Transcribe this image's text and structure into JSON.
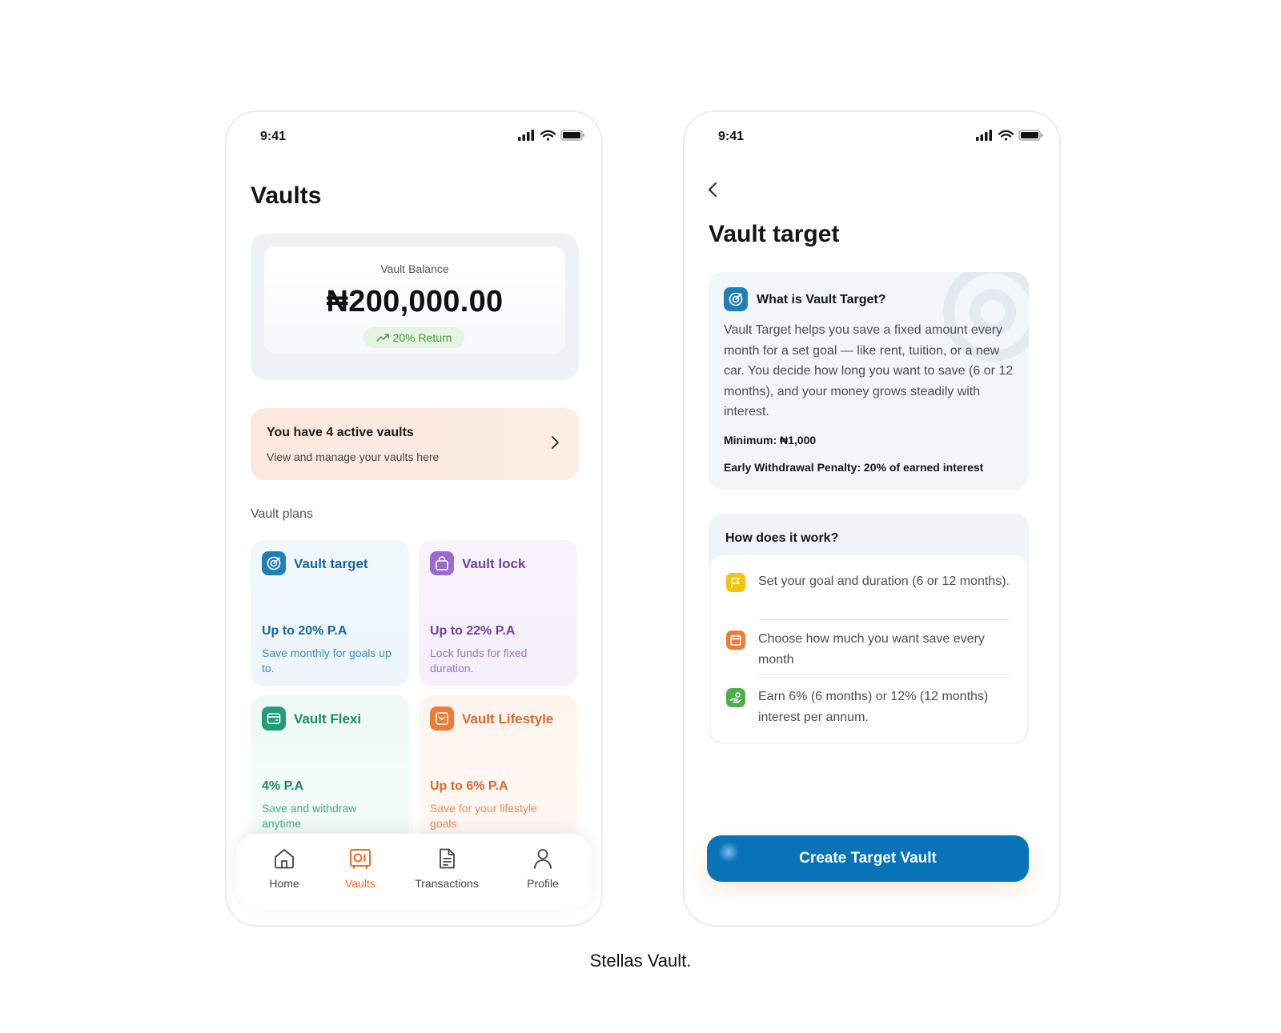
{
  "caption": "Stellas Vault.",
  "colors": {
    "accent_orange": "#ee6a1e",
    "primary_blue": "#0873b6",
    "target_blue": "#1f7fb8",
    "lock_purple": "#9b6ad1",
    "flexi_green": "#1f9e79",
    "lifestyle_orange": "#ee7a36"
  },
  "vaults_screen": {
    "status_time": "9:41",
    "status_icons": [
      "signal-icon",
      "wifi-icon",
      "battery-icon"
    ],
    "title": "Vaults",
    "balance": {
      "label": "Vault Balance",
      "amount": "₦200,000.00",
      "return_badge": "20% Return"
    },
    "active_vaults": {
      "title": "You have 4 active vaults",
      "subtitle": "View and manage your vaults here"
    },
    "plans_label": "Vault plans",
    "plans": [
      {
        "name": "Vault target",
        "icon": "target-icon",
        "rate": "Up to 20% P.A",
        "description": "Save monthly for goals up to."
      },
      {
        "name": "Vault lock",
        "icon": "bag-lock-icon",
        "rate": "Up to 22% P.A",
        "description": "Lock funds for fixed duration."
      },
      {
        "name": "Vault Flexi",
        "icon": "wallet-icon",
        "rate": "4% P.A",
        "description": "Save and withdraw anytime"
      },
      {
        "name": "Vault Lifestyle",
        "icon": "inbox-icon",
        "rate": "Up to 6% P.A",
        "description": "Save for your lifestyle goals"
      }
    ],
    "nav": [
      {
        "label": "Home",
        "icon": "home-icon",
        "active": false
      },
      {
        "label": "Vaults",
        "icon": "vault-icon",
        "active": true
      },
      {
        "label": "Transactions",
        "icon": "document-icon",
        "active": false
      },
      {
        "label": "Profile",
        "icon": "user-icon",
        "active": false
      }
    ]
  },
  "target_screen": {
    "status_time": "9:41",
    "title": "Vault target",
    "info": {
      "title": "What is Vault Target?",
      "body": "Vault Target helps you save a fixed amount every month for a set goal — like rent, tuition, or a new car. You decide how long you want to save (6 or 12 months), and your money grows steadily with interest.",
      "minimum": "Minimum: ₦1,000",
      "penalty": "Early Withdrawal Penalty: 20% of earned interest"
    },
    "how": {
      "title": "How does it work?",
      "steps": [
        {
          "icon": "flag-icon",
          "text": "Set your goal and duration (6 or 12 months)."
        },
        {
          "icon": "calendar-icon",
          "text": "Choose how much you want save every month"
        },
        {
          "icon": "money-hand-icon",
          "text": "Earn 6% (6 months) or 12% (12 months) interest per annum."
        }
      ]
    },
    "cta": "Create Target Vault"
  }
}
